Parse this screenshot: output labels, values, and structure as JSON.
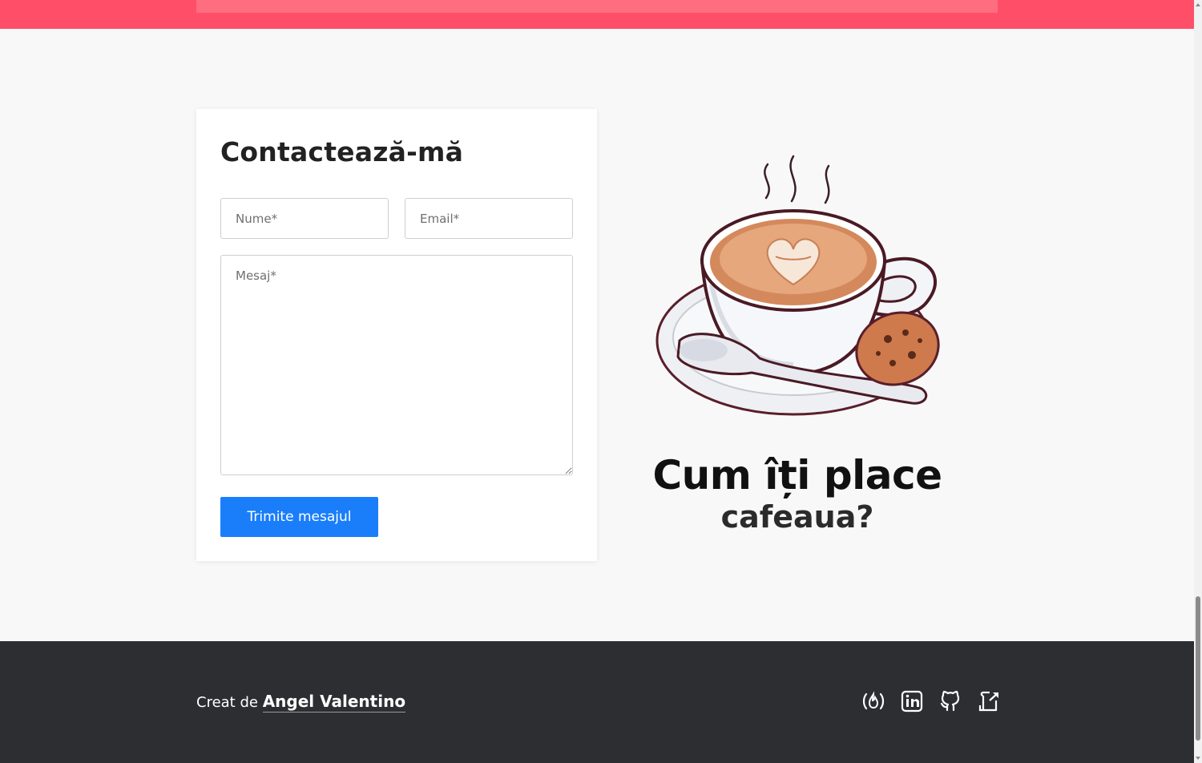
{
  "contact": {
    "title": "Contactează-mă",
    "name_placeholder": "Nume*",
    "email_placeholder": "Email*",
    "message_placeholder": "Mesaj*",
    "submit_label": "Trimite mesajul"
  },
  "tagline": {
    "line1": "Cum îți place",
    "line2": "cafeaua?"
  },
  "footer": {
    "credit_prefix": "Creat de",
    "author": "Angel Valentino",
    "socials": [
      {
        "icon": "freecodecamp-icon"
      },
      {
        "icon": "linkedin-icon"
      },
      {
        "icon": "github-icon"
      },
      {
        "icon": "external-link-icon"
      }
    ]
  },
  "colors": {
    "accent": "#1a7efb",
    "top_band": "#ff4f68",
    "footer_bg": "#2d2e32"
  }
}
